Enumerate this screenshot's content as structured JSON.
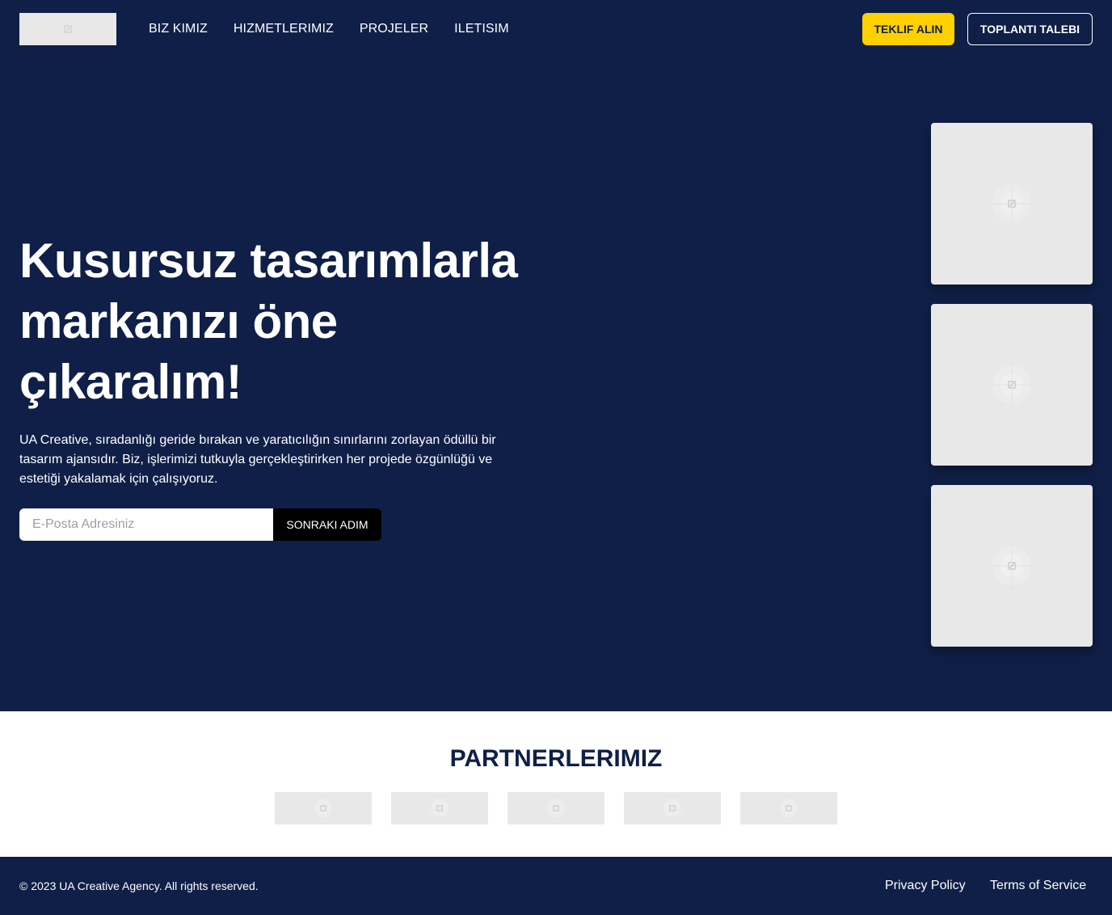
{
  "header": {
    "nav": [
      "BIZ KIMIZ",
      "HIZMETLERIMIZ",
      "PROJELER",
      "ILETISIM"
    ],
    "quote_button": "TEKLIF ALIN",
    "meeting_button": "TOPLANTI TALEBI"
  },
  "hero": {
    "headline_lines": [
      "Kusursuz tasarımlarla",
      "markanızı öne",
      "çıkaralım!"
    ],
    "description": "UA Creative, sıradanlığı geride bırakan ve yaratıcılığın sınırlarını zorlayan ödüllü bir tasarım ajansıdır. Biz, işlerimizi tutkuyla gerçekleştirirken her projede özgünlüğü ve estetiği yakalamak için çalışıyoruz.",
    "email_placeholder": "E-Posta Adresiniz",
    "next_button": "SONRAKI ADIM"
  },
  "partners": {
    "title": "PARTNERLERIMIZ"
  },
  "footer": {
    "copyright": "© 2023 UA Creative Agency. All rights reserved.",
    "privacy": "Privacy Policy",
    "terms": "Terms of Service"
  },
  "colors": {
    "navy": "#0f1f47",
    "accent_yellow": "#ffd000",
    "placeholder_gray": "#e8e8e8"
  },
  "icons": [
    "image-placeholder-icon"
  ]
}
